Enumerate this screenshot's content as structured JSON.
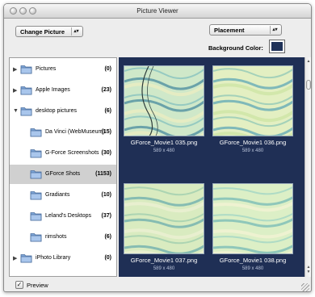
{
  "window": {
    "title": "Picture Viewer"
  },
  "toolbar": {
    "change_picture_label": "Change Picture",
    "placement_label": "Placement",
    "background_color_label": "Background Color:",
    "background_color": "#1f3158"
  },
  "sidebar": {
    "items": [
      {
        "label": "Pictures",
        "count": "(0)",
        "level": 0,
        "disclosure": "▶",
        "selected": false
      },
      {
        "label": "Apple Images",
        "count": "(23)",
        "level": 0,
        "disclosure": "▶",
        "selected": false
      },
      {
        "label": "desktop pictures",
        "count": "(6)",
        "level": 0,
        "disclosure": "▼",
        "selected": false
      },
      {
        "label": "Da Vinci (WebMuseum)",
        "count": "(15)",
        "level": 1,
        "disclosure": "",
        "selected": false
      },
      {
        "label": "G-Force Screenshots",
        "count": "(30)",
        "level": 1,
        "disclosure": "",
        "selected": false
      },
      {
        "label": "GForce Shots",
        "count": "(1153)",
        "level": 1,
        "disclosure": "",
        "selected": true
      },
      {
        "label": "Gradiants",
        "count": "(10)",
        "level": 1,
        "disclosure": "",
        "selected": false
      },
      {
        "label": "Leland's Desktops",
        "count": "(37)",
        "level": 1,
        "disclosure": "",
        "selected": false
      },
      {
        "label": "rimshots",
        "count": "(6)",
        "level": 1,
        "disclosure": "",
        "selected": false
      },
      {
        "label": "iPhoto Library",
        "count": "(0)",
        "level": 0,
        "disclosure": "▶",
        "selected": false
      }
    ]
  },
  "gallery": {
    "thumbnails": [
      {
        "name": "GForce_Movie1 035.png",
        "dims": "589 x 480"
      },
      {
        "name": "GForce_Movie1 036.png",
        "dims": "589 x 480"
      },
      {
        "name": "GForce_Movie1 037.png",
        "dims": "589 x 480"
      },
      {
        "name": "GForce_Movie1 038.png",
        "dims": "589 x 480"
      }
    ]
  },
  "footer": {
    "preview_label": "Preview",
    "preview_checked": true,
    "check_mark": "✓"
  }
}
